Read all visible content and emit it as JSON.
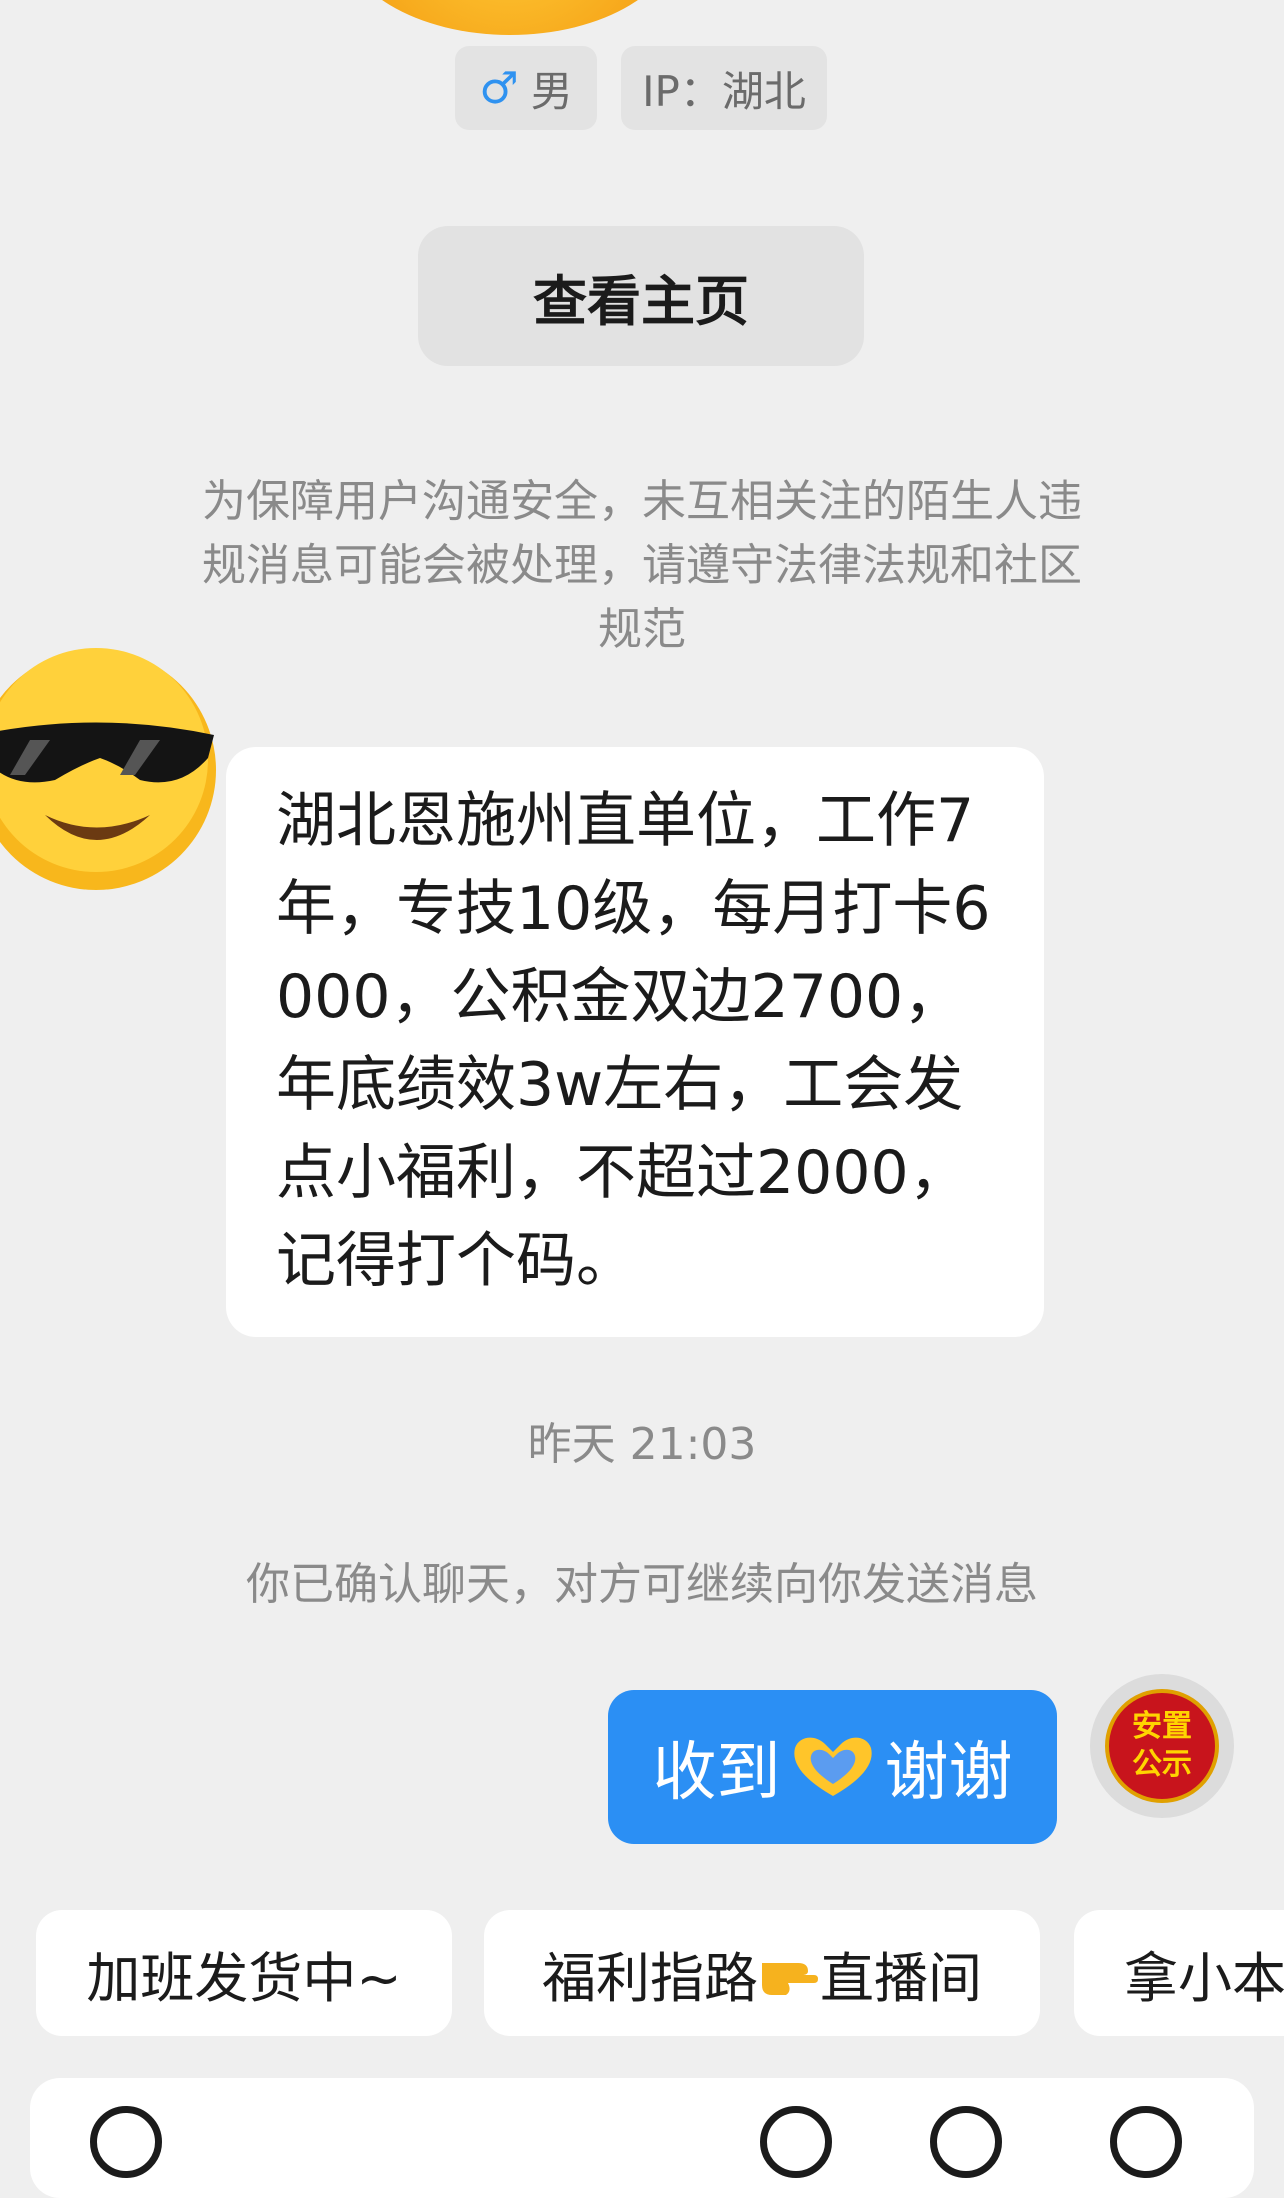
{
  "profile": {
    "gender_symbol": "♂",
    "gender_label": "男",
    "ip_label": "IP：湖北"
  },
  "view_home_label": "查看主页",
  "notice": "为保障用户沟通安全，未互相关注的陌生人违规消息可能会被处理，请遵守法律法规和社区规范",
  "incoming_message": "湖北恩施州直单位，工作7年，专技10级，每月打卡6000，公积金双边2700，年底绩效3w左右，工会发点小福利，不超过2000，记得打个码。",
  "timestamp": "昨天 21:03",
  "confirm_notice": "你已确认聊天，对方可继续向你发送消息",
  "outgoing_message": {
    "before_emoji": "收到",
    "emoji": "heart-hands-icon",
    "after_emoji": "谢谢"
  },
  "my_avatar_text": [
    "安置",
    "公示"
  ],
  "quick_replies": [
    {
      "label": "加班发货中~"
    },
    {
      "before": "福利指路",
      "emoji": "pointing-right-icon",
      "after": "直播间"
    },
    {
      "label": "拿小本"
    }
  ],
  "colors": {
    "background": "#efefef",
    "outgoing_bubble": "#2b8ff4",
    "incoming_bubble": "#ffffff",
    "gender_accent": "#2f92f0"
  }
}
